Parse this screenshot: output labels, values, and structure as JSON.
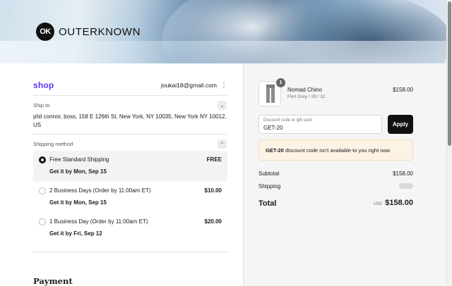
{
  "brand": {
    "logo_mark": "OK",
    "name": "OUTERKNOWN"
  },
  "shop_pay": {
    "label": "shop",
    "email": "joukai18@gmail.com",
    "menu_icon": "kebab-icon"
  },
  "ship_to": {
    "label": "Ship to",
    "address": "phil connor, boss, 158 E 126th St, New York, NY 10035, New York NY 10012, US"
  },
  "shipping_method": {
    "label": "Shipping method",
    "options": [
      {
        "name": "Free Standard Shipping",
        "price": "FREE",
        "eta": "Get it by Mon, Sep 15",
        "selected": true
      },
      {
        "name": "2 Business Days (Order by 11:00am ET)",
        "price": "$10.00",
        "eta": "Get it by Mon, Sep 15",
        "selected": false
      },
      {
        "name": "1 Business Day (Order by 11:00am ET)",
        "price": "$20.00",
        "eta": "Get it by Fri, Sep 12",
        "selected": false
      }
    ]
  },
  "payment": {
    "title": "Payment"
  },
  "cart": {
    "item": {
      "quantity": "1",
      "name": "Nomad Chino",
      "variant": "Flint Grey / 28 / 32",
      "price": "$158.00"
    }
  },
  "discount": {
    "placeholder": "Discount code or gift card",
    "value": "GET-20",
    "apply_label": "Apply",
    "notice_code": "GET-20",
    "notice_text": " discount code isn't available to you right now"
  },
  "summary": {
    "subtotal_label": "Subtotal",
    "subtotal_value": "$158.00",
    "shipping_label": "Shipping",
    "total_label": "Total",
    "currency": "USD",
    "total_value": "$158.00"
  }
}
